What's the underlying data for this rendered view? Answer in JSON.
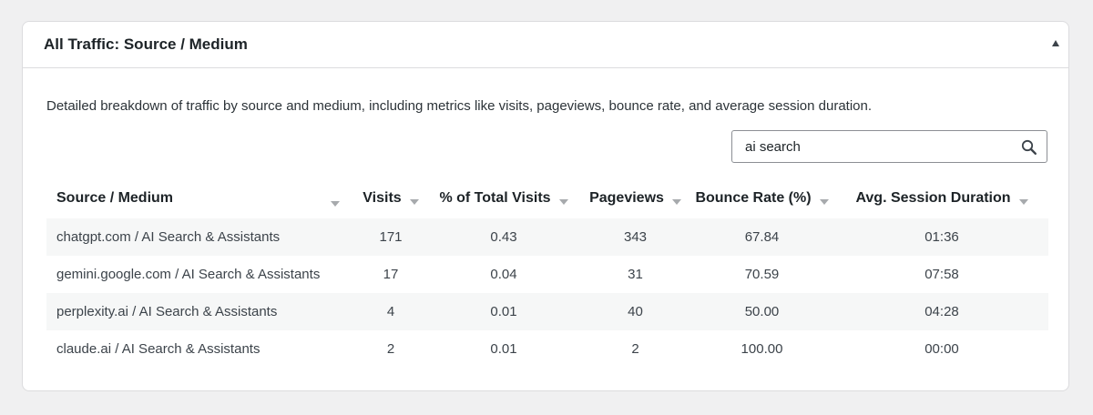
{
  "panel": {
    "title": "All Traffic: Source / Medium",
    "collapse_icon": "triangle-up-icon",
    "description": "Detailed breakdown of traffic by source and medium, including metrics like visits, pageviews, bounce rate, and average session duration."
  },
  "search": {
    "value": "ai search",
    "icon": "search-icon"
  },
  "table": {
    "headers": [
      "Source / Medium",
      "Visits",
      "% of Total Visits",
      "Pageviews",
      "Bounce Rate (%)",
      "Avg. Session Duration"
    ],
    "rows": [
      [
        "chatgpt.com / AI Search & Assistants",
        "171",
        "0.43",
        "343",
        "67.84",
        "01:36"
      ],
      [
        "gemini.google.com / AI Search & Assistants",
        "17",
        "0.04",
        "31",
        "70.59",
        "07:58"
      ],
      [
        "perplexity.ai / AI Search & Assistants",
        "4",
        "0.01",
        "40",
        "50.00",
        "04:28"
      ],
      [
        "claude.ai / AI Search & Assistants",
        "2",
        "0.01",
        "2",
        "100.00",
        "00:00"
      ]
    ]
  }
}
